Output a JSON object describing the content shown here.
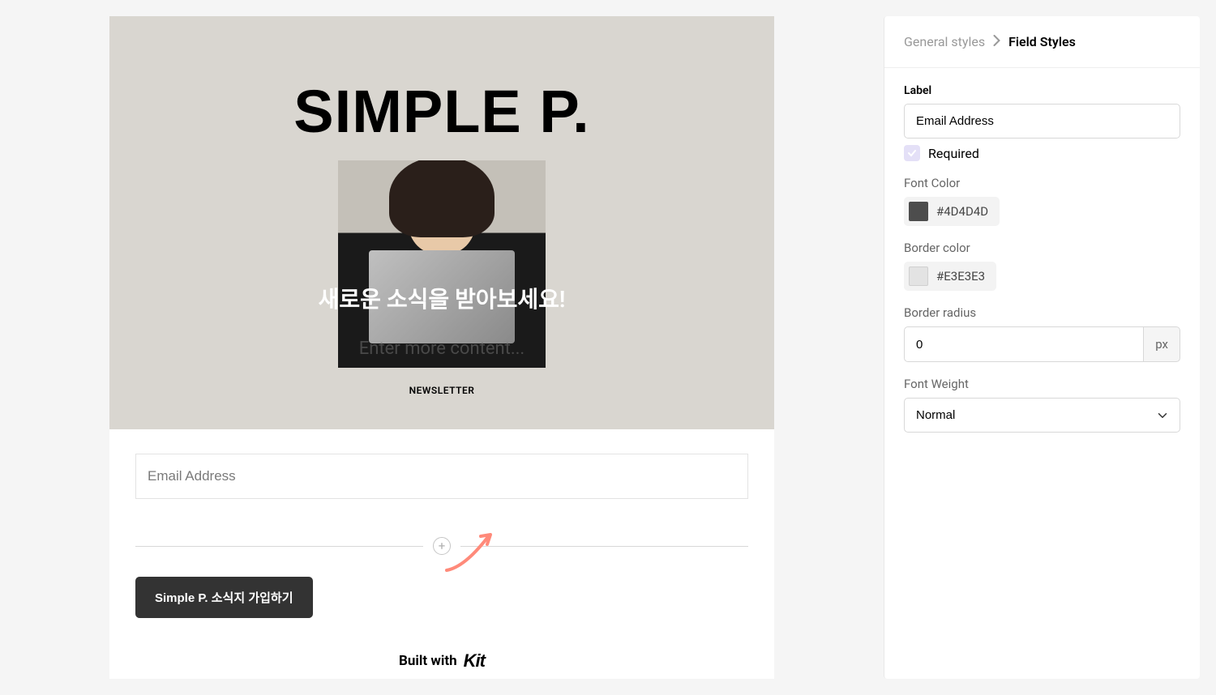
{
  "preview": {
    "hero_title": "SIMPLE P.",
    "overlay_text": "새로운 소식을 받아보세요!",
    "content_placeholder": "Enter more content...",
    "newsletter_label": "NEWSLETTER",
    "email_placeholder": "Email Address",
    "submit_label": "Simple P. 소식지 가입하기",
    "built_with_text": "Built with",
    "built_with_brand": "Kit"
  },
  "sidebar": {
    "breadcrumb_prev": "General styles",
    "breadcrumb_current": "Field Styles",
    "label_field": {
      "title": "Label",
      "value": "Email Address"
    },
    "required": {
      "label": "Required",
      "checked": true
    },
    "font_color": {
      "title": "Font Color",
      "hex": "#4D4D4D",
      "swatch": "#4D4D4D"
    },
    "border_color": {
      "title": "Border color",
      "hex": "#E3E3E3",
      "swatch": "#E3E3E3"
    },
    "border_radius": {
      "title": "Border radius",
      "value": "0",
      "unit": "px"
    },
    "font_weight": {
      "title": "Font Weight",
      "value": "Normal"
    }
  }
}
